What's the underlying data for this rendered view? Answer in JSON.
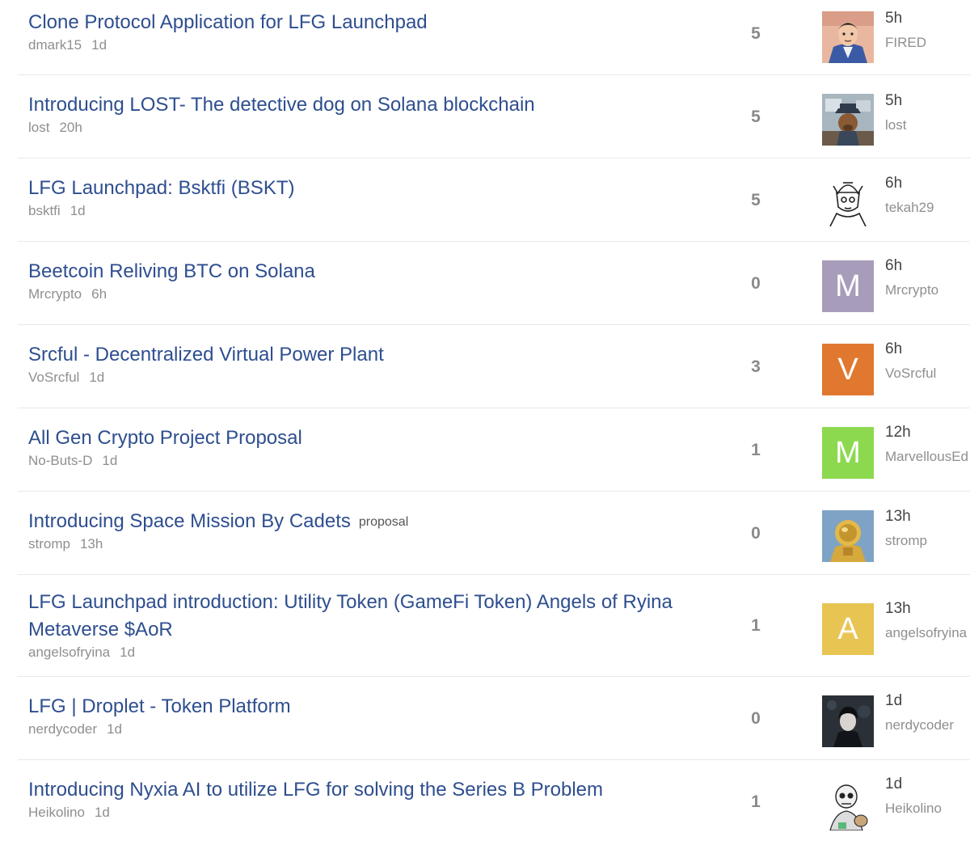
{
  "topics": [
    {
      "title": "Clone Protocol Application for LFG Launchpad",
      "author": "dmark15",
      "age": "1d",
      "replies": "5",
      "last_ago": "5h",
      "last_poster": "FIRED",
      "avatar": {
        "kind": "image",
        "icon": "portrait-illustration-icon"
      }
    },
    {
      "title": "Introducing LOST- The detective dog on Solana blockchain",
      "author": "lost",
      "age": "20h",
      "replies": "5",
      "last_ago": "5h",
      "last_poster": "lost",
      "avatar": {
        "kind": "image",
        "icon": "detective-dog-icon"
      }
    },
    {
      "title": "LFG Launchpad: Bsktfi (BSKT)",
      "author": "bsktfi",
      "age": "1d",
      "replies": "5",
      "last_ago": "6h",
      "last_poster": "tekah29",
      "avatar": {
        "kind": "image",
        "icon": "sketch-character-icon"
      }
    },
    {
      "title": "Beetcoin Reliving BTC on Solana",
      "author": "Mrcrypto",
      "age": "6h",
      "replies": "0",
      "last_ago": "6h",
      "last_poster": "Mrcrypto",
      "avatar": {
        "kind": "letter",
        "letter": "M",
        "color": "#a79cba"
      }
    },
    {
      "title": "Srcful - Decentralized Virtual Power Plant",
      "author": "VoSrcful",
      "age": "1d",
      "replies": "3",
      "last_ago": "6h",
      "last_poster": "VoSrcful",
      "avatar": {
        "kind": "letter",
        "letter": "V",
        "color": "#e1782f"
      }
    },
    {
      "title": "All Gen Crypto Project Proposal",
      "author": "No-Buts-D",
      "age": "1d",
      "replies": "1",
      "last_ago": "12h",
      "last_poster": "MarvellousEd",
      "avatar": {
        "kind": "letter",
        "letter": "M",
        "color": "#8cd94f"
      }
    },
    {
      "title": "Introducing Space Mission By Cadets",
      "tag": "proposal",
      "author": "stromp",
      "age": "13h",
      "replies": "0",
      "last_ago": "13h",
      "last_poster": "stromp",
      "avatar": {
        "kind": "image",
        "icon": "golden-astronaut-icon"
      }
    },
    {
      "title": "LFG Launchpad introduction: Utility Token (GameFi Token) Angels of Ryina Metaverse $AoR",
      "author": "angelsofryina",
      "age": "1d",
      "replies": "1",
      "last_ago": "13h",
      "last_poster": "angelsofryina",
      "avatar": {
        "kind": "letter",
        "letter": "A",
        "color": "#e8c452"
      }
    },
    {
      "title": "LFG | Droplet - Token Platform",
      "author": "nerdycoder",
      "age": "1d",
      "replies": "0",
      "last_ago": "1d",
      "last_poster": "nerdycoder",
      "avatar": {
        "kind": "image",
        "icon": "dark-anime-character-icon"
      }
    },
    {
      "title": "Introducing Nyxia AI to utilize LFG for solving the Series B Problem",
      "author": "Heikolino",
      "age": "1d",
      "replies": "1",
      "last_ago": "1d",
      "last_poster": "Heikolino",
      "avatar": {
        "kind": "image",
        "icon": "skeleton-cartoon-icon"
      }
    }
  ]
}
